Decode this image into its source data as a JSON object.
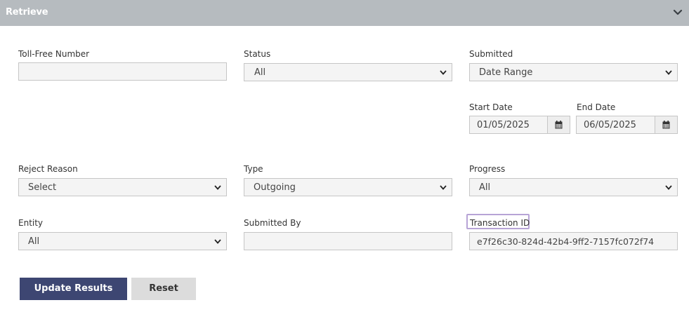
{
  "header": {
    "title": "Retrieve"
  },
  "form": {
    "toll_free_number": {
      "label": "Toll-Free Number",
      "value": ""
    },
    "status": {
      "label": "Status",
      "value": "All"
    },
    "submitted": {
      "label": "Submitted",
      "value": "Date Range"
    },
    "start_date": {
      "label": "Start Date",
      "value": "01/05/2025"
    },
    "end_date": {
      "label": "End Date",
      "value": "06/05/2025"
    },
    "reject_reason": {
      "label": "Reject Reason",
      "value": "Select"
    },
    "type": {
      "label": "Type",
      "value": "Outgoing"
    },
    "progress": {
      "label": "Progress",
      "value": "All"
    },
    "entity": {
      "label": "Entity",
      "value": "All"
    },
    "submitted_by": {
      "label": "Submitted By",
      "value": ""
    },
    "transaction_id": {
      "label": "Transaction ID",
      "value": "e7f26c30-824d-42b4-9ff2-7157fc072f74"
    }
  },
  "buttons": {
    "update": "Update Results",
    "reset": "Reset"
  },
  "colors": {
    "header_bg": "#b6bbbf",
    "primary_button": "#3d4672",
    "highlight": "#b7a4d6"
  },
  "icons": {
    "collapse": "chevron-down-icon",
    "calendar": "calendar-icon",
    "dropdown": "dropdown-arrow-icon"
  }
}
